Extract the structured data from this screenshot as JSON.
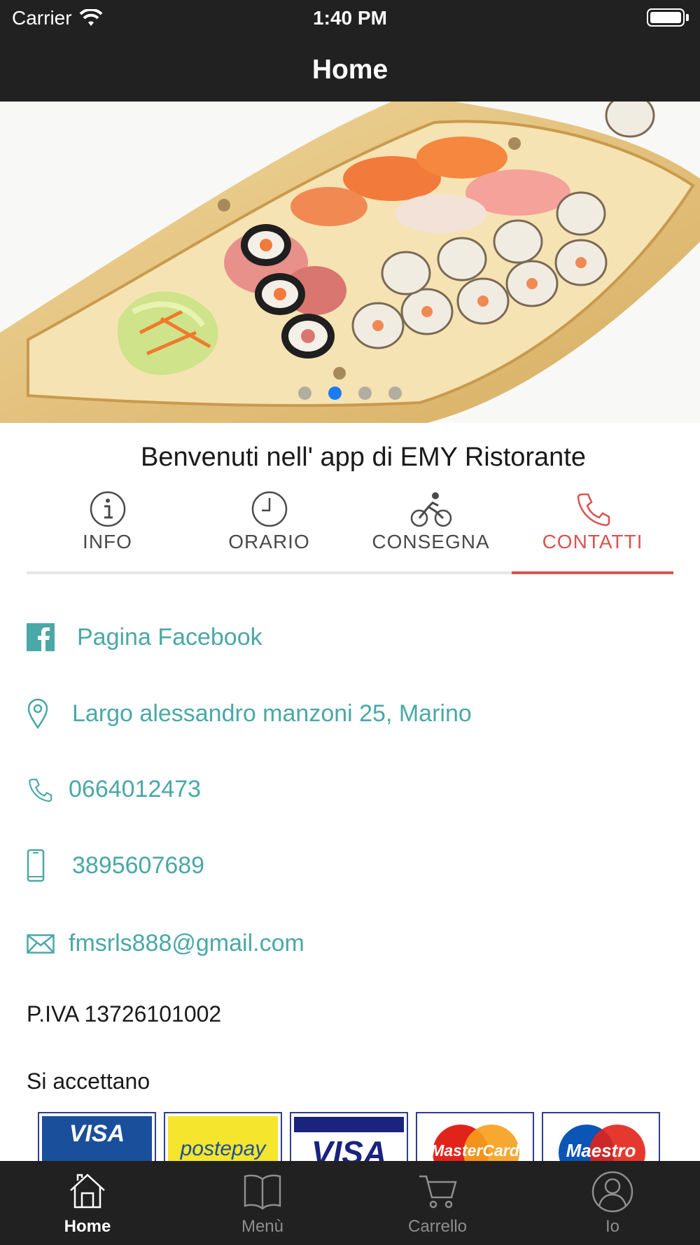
{
  "status_bar": {
    "carrier": "Carrier",
    "time": "1:40 PM"
  },
  "nav": {
    "title": "Home"
  },
  "hero": {
    "slide_count": 4,
    "active_slide": 2
  },
  "welcome": "Benvenuti nell' app di EMY Ristorante",
  "tabs": [
    {
      "label": "INFO",
      "icon": "info-icon"
    },
    {
      "label": "ORARIO",
      "icon": "clock-icon"
    },
    {
      "label": "CONSEGNA",
      "icon": "bicycle-icon"
    },
    {
      "label": "CONTATTI",
      "icon": "phone-icon",
      "active": true
    }
  ],
  "contacts": {
    "facebook": "Pagina Facebook",
    "address": "Largo alessandro manzoni 25, Marino",
    "phone": "0664012473",
    "mobile": "3895607689",
    "email": "fmsrls888@gmail.com"
  },
  "piva": "P.IVA 13726101002",
  "accept_title": "Si accettano",
  "payment_cards": [
    "VISA",
    "postepay",
    "VISA",
    "MasterCard",
    "Maestro"
  ],
  "bottom_tabs": [
    {
      "label": "Home",
      "icon": "home-icon",
      "active": true
    },
    {
      "label": "Menù",
      "icon": "book-icon"
    },
    {
      "label": "Carrello",
      "icon": "cart-icon"
    },
    {
      "label": "Io",
      "icon": "user-icon"
    }
  ],
  "colors": {
    "accent": "#d9534f",
    "link": "#4aa8a6",
    "bar": "#212121",
    "active_dot": "#1a7cf2"
  }
}
